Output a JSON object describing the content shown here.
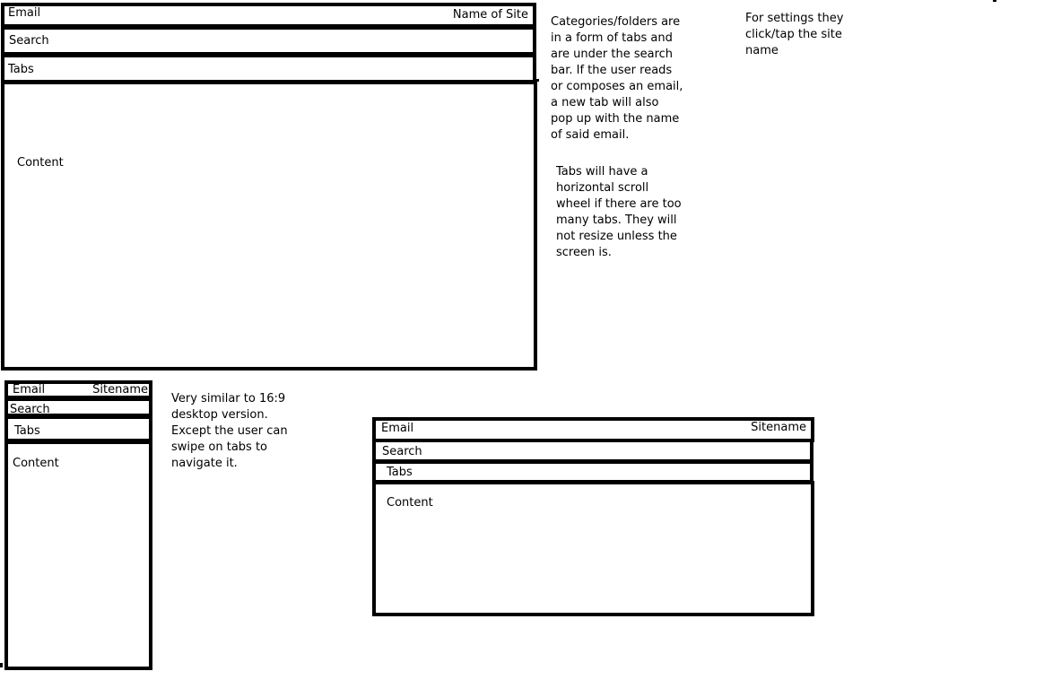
{
  "desktop": {
    "email_label": "Email",
    "site_label": "Name of Site",
    "search_label": "Search",
    "tabs_label": "Tabs",
    "content_label": "Content"
  },
  "desktop_notes": {
    "categories": [
      "Categories/folders are",
      "in a form of tabs and",
      "are under the search",
      "bar. If the user reads",
      "or composes an email,",
      "a new tab will also",
      "pop up with the name",
      "of said email."
    ],
    "tabs_scroll": [
      "Tabs will have a",
      "horizontal scroll",
      "wheel if there are too",
      "many tabs. They will",
      "not resize unless the",
      "screen is."
    ],
    "settings": [
      "For settings they",
      "click/tap the site",
      "name"
    ]
  },
  "mobile": {
    "email_label": "Email",
    "site_label": "Sitename",
    "search_label": "Search",
    "tabs_label": "Tabs",
    "content_label": "Content"
  },
  "mobile_notes": {
    "similar": [
      "Very similar to 16:9",
      "desktop version.",
      "Except the user can",
      "swipe on tabs to",
      "navigate it."
    ]
  },
  "tablet": {
    "email_label": "Email",
    "site_label": "Sitename",
    "search_label": "Search",
    "tabs_label": "Tabs",
    "content_label": "Content"
  }
}
